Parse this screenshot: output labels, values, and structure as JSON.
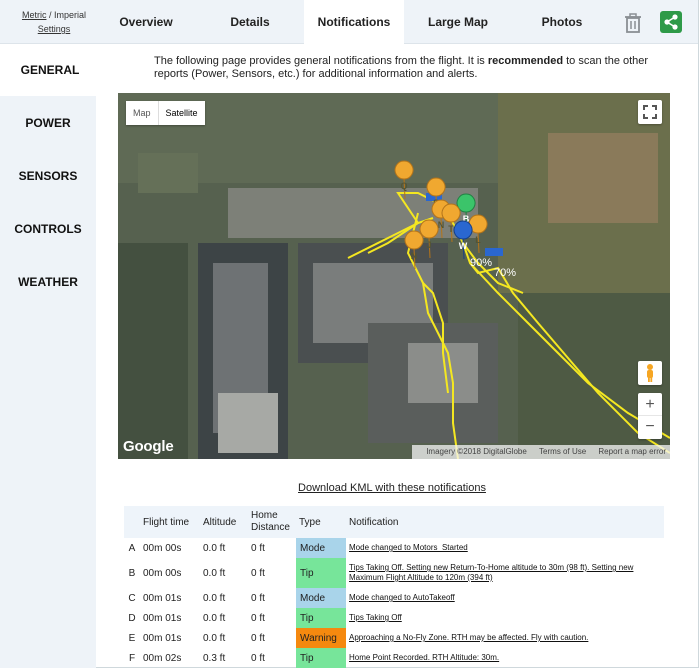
{
  "units": {
    "metric": "Metric",
    "separator": "/",
    "imperial": "Imperial",
    "settings": "Settings"
  },
  "tabs": [
    {
      "label": "Overview"
    },
    {
      "label": "Details"
    },
    {
      "label": "Notifications"
    },
    {
      "label": "Large Map"
    },
    {
      "label": "Photos"
    }
  ],
  "sidebar": {
    "items": [
      {
        "label": "GENERAL"
      },
      {
        "label": "POWER"
      },
      {
        "label": "SENSORS"
      },
      {
        "label": "CONTROLS"
      },
      {
        "label": "WEATHER"
      }
    ]
  },
  "intro": {
    "before": "The following page provides general notifications from the flight. It is ",
    "bold": "recommended",
    "after": " to scan the other reports (Power, Sensors, etc.) for additional information and alerts."
  },
  "map": {
    "type_map": "Map",
    "type_satellite": "Satellite",
    "brand": "Google",
    "attribution_imagery": "Imagery ©2018 DigitalGlobe",
    "attribution_terms": "Terms of Use",
    "attribution_report": "Report a map error",
    "zoom_in": "+",
    "zoom_out": "−",
    "battery_start": "90%",
    "battery_end": "70%",
    "markers": [
      "Q",
      "S",
      "A",
      "N",
      "T",
      "B",
      "J",
      "N",
      "W",
      "L",
      "H"
    ]
  },
  "download_link": "Download KML with these notifications",
  "table": {
    "headers": [
      "",
      "Flight time",
      "Altitude",
      "Home Distance",
      "Type",
      "Notification"
    ],
    "rows": [
      {
        "label": "A",
        "time": "00m 00s",
        "altitude": "0.0 ft",
        "distance": "0 ft",
        "type": "Mode",
        "type_color": "#a9d4ea",
        "note": "Mode changed to Motors_Started"
      },
      {
        "label": "B",
        "time": "00m 00s",
        "altitude": "0.0 ft",
        "distance": "0 ft",
        "type": "Tip",
        "type_color": "#77e59a",
        "note": "Tips   Taking Off. Setting new Return-To-Home altitude to 30m (98 ft). Setting new Maximum Flight Altitude to 120m (394 ft)"
      },
      {
        "label": "C",
        "time": "00m 01s",
        "altitude": "0.0 ft",
        "distance": "0 ft",
        "type": "Mode",
        "type_color": "#a9d4ea",
        "note": "Mode changed to AutoTakeoff"
      },
      {
        "label": "D",
        "time": "00m 01s",
        "altitude": "0.0 ft",
        "distance": "0 ft",
        "type": "Tip",
        "type_color": "#77e59a",
        "note": "Tips   Taking Off"
      },
      {
        "label": "E",
        "time": "00m 01s",
        "altitude": "0.0 ft",
        "distance": "0 ft",
        "type": "Warning",
        "type_color": "#f5890f",
        "note": "Approaching a No-Fly Zone. RTH may be affected. Fly with caution."
      },
      {
        "label": "F",
        "time": "00m 02s",
        "altitude": "0.3 ft",
        "distance": "0 ft",
        "type": "Tip",
        "type_color": "#77e59a",
        "note": "Home Point Recorded. RTH Altitude:  30m."
      }
    ]
  }
}
